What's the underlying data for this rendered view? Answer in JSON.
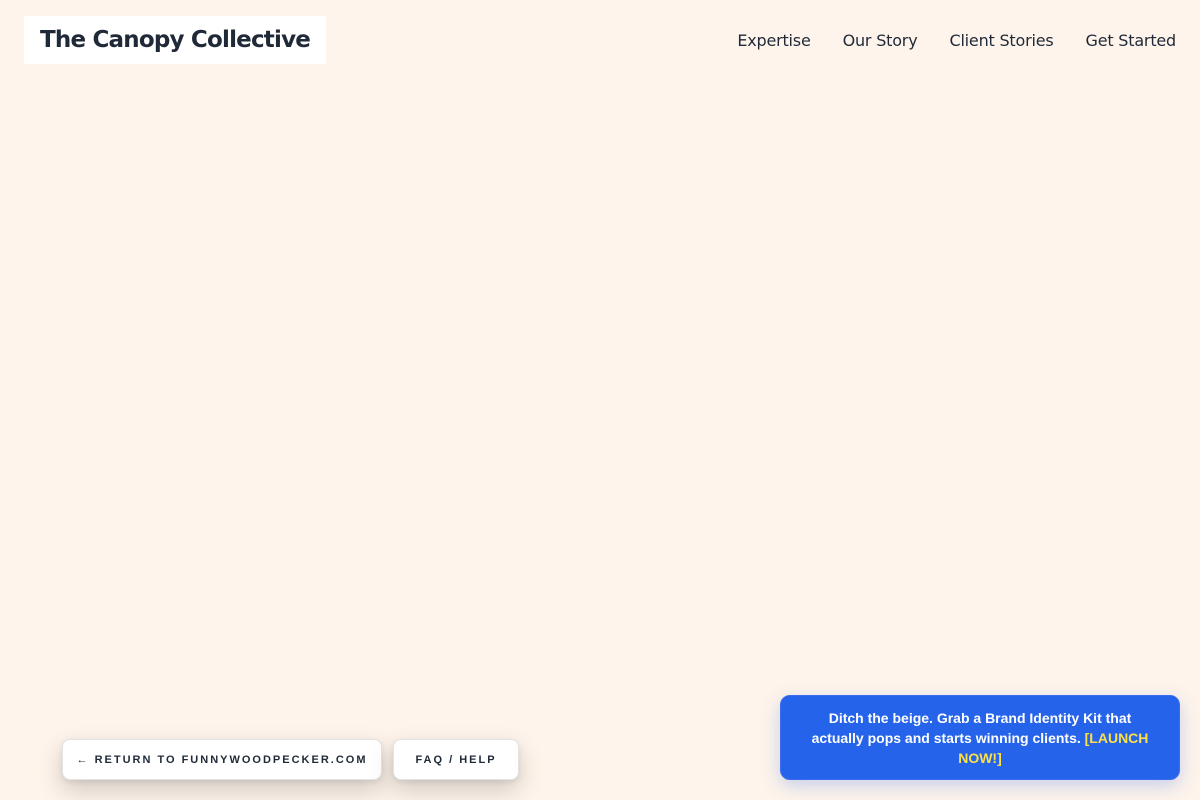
{
  "brand": {
    "name": "The Canopy Collective"
  },
  "nav": {
    "items": [
      {
        "label": "Expertise"
      },
      {
        "label": "Our Story"
      },
      {
        "label": "Client Stories"
      },
      {
        "label": "Get Started"
      }
    ]
  },
  "footer_links": {
    "return_label": "← RETURN TO FUNNYWOODPECKER.COM",
    "faq_label": "FAQ / HELP"
  },
  "promo": {
    "text": "Ditch the beige. Grab a Brand Identity Kit that actually pops and starts winning clients. ",
    "cta": "[LAUNCH NOW!]"
  },
  "colors": {
    "background": "#fef4eb",
    "promo_bg": "#2563eb",
    "cta": "#fde047"
  }
}
